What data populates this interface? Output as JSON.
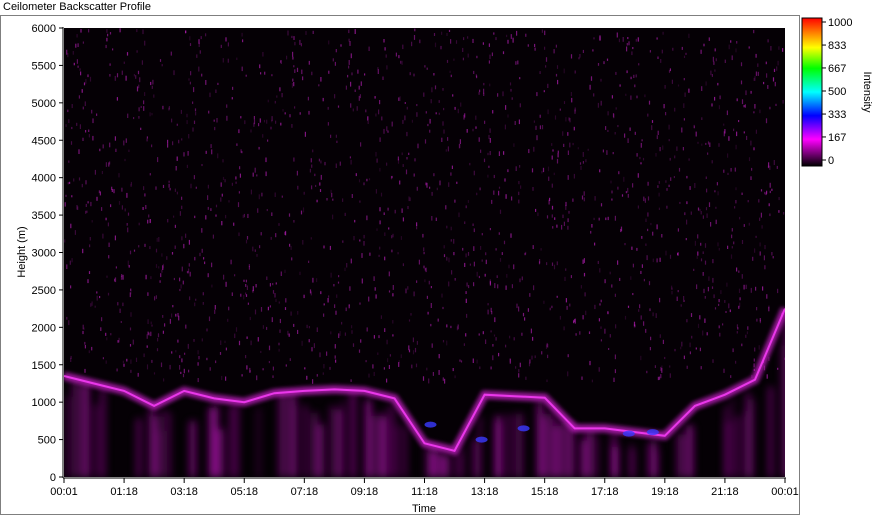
{
  "window": {
    "title": "Ceilometer Backscatter Profile"
  },
  "chart_data": {
    "type": "heatmap",
    "title": "Ceilometer Backscatter Profile",
    "xlabel": "Time",
    "ylabel": "Height (m)",
    "x_ticks": [
      "00:01",
      "01:18",
      "03:18",
      "05:18",
      "07:18",
      "09:18",
      "11:18",
      "13:18",
      "15:18",
      "17:18",
      "19:18",
      "21:18",
      "00:01"
    ],
    "y_ticks": [
      0,
      500,
      1000,
      1500,
      2000,
      2500,
      3000,
      3500,
      4000,
      4500,
      5000,
      5500,
      6000
    ],
    "ylim": [
      0,
      6000
    ],
    "colorbar": {
      "label": "Intensity",
      "ticks": [
        1000,
        833,
        667,
        500,
        333,
        167,
        0
      ],
      "range": [
        0,
        1000
      ],
      "colors": [
        "#000000",
        "#ff00ff",
        "#0000ff",
        "#00ffff",
        "#00ff00",
        "#ffff00",
        "#ff8000",
        "#ff0000"
      ]
    },
    "features": {
      "boundary_layer_height_m": [
        [
          0,
          1350
        ],
        [
          1,
          1250
        ],
        [
          2,
          1150
        ],
        [
          3,
          950
        ],
        [
          4,
          1150
        ],
        [
          5,
          1050
        ],
        [
          6,
          1000
        ],
        [
          7,
          1120
        ],
        [
          8,
          1150
        ],
        [
          9,
          1170
        ],
        [
          10,
          1150
        ],
        [
          11,
          1050
        ],
        [
          12,
          450
        ],
        [
          13,
          350
        ],
        [
          14,
          1100
        ],
        [
          15,
          1080
        ],
        [
          16,
          1060
        ],
        [
          17,
          650
        ],
        [
          18,
          650
        ],
        [
          19,
          600
        ],
        [
          20,
          550
        ],
        [
          21,
          950
        ],
        [
          22,
          1100
        ],
        [
          23,
          1300
        ],
        [
          24,
          2250
        ]
      ],
      "grid": false
    }
  }
}
